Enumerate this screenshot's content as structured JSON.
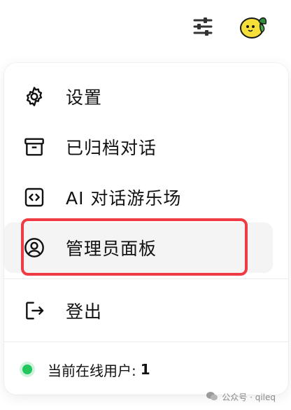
{
  "menu": {
    "items": [
      {
        "label": "设置",
        "icon": "gear-icon"
      },
      {
        "label": "已归档对话",
        "icon": "archive-icon"
      },
      {
        "label": "AI 对话游乐场",
        "icon": "code-icon"
      },
      {
        "label": "管理员面板",
        "icon": "user-circle-icon"
      },
      {
        "label": "登出",
        "icon": "logout-icon"
      }
    ],
    "status": {
      "label": "当前在线用户:",
      "count": "1",
      "dot_color": "#22c55e"
    }
  },
  "watermark": {
    "text": "公众号 · qileq"
  },
  "colors": {
    "highlight": "#ef3b44"
  }
}
